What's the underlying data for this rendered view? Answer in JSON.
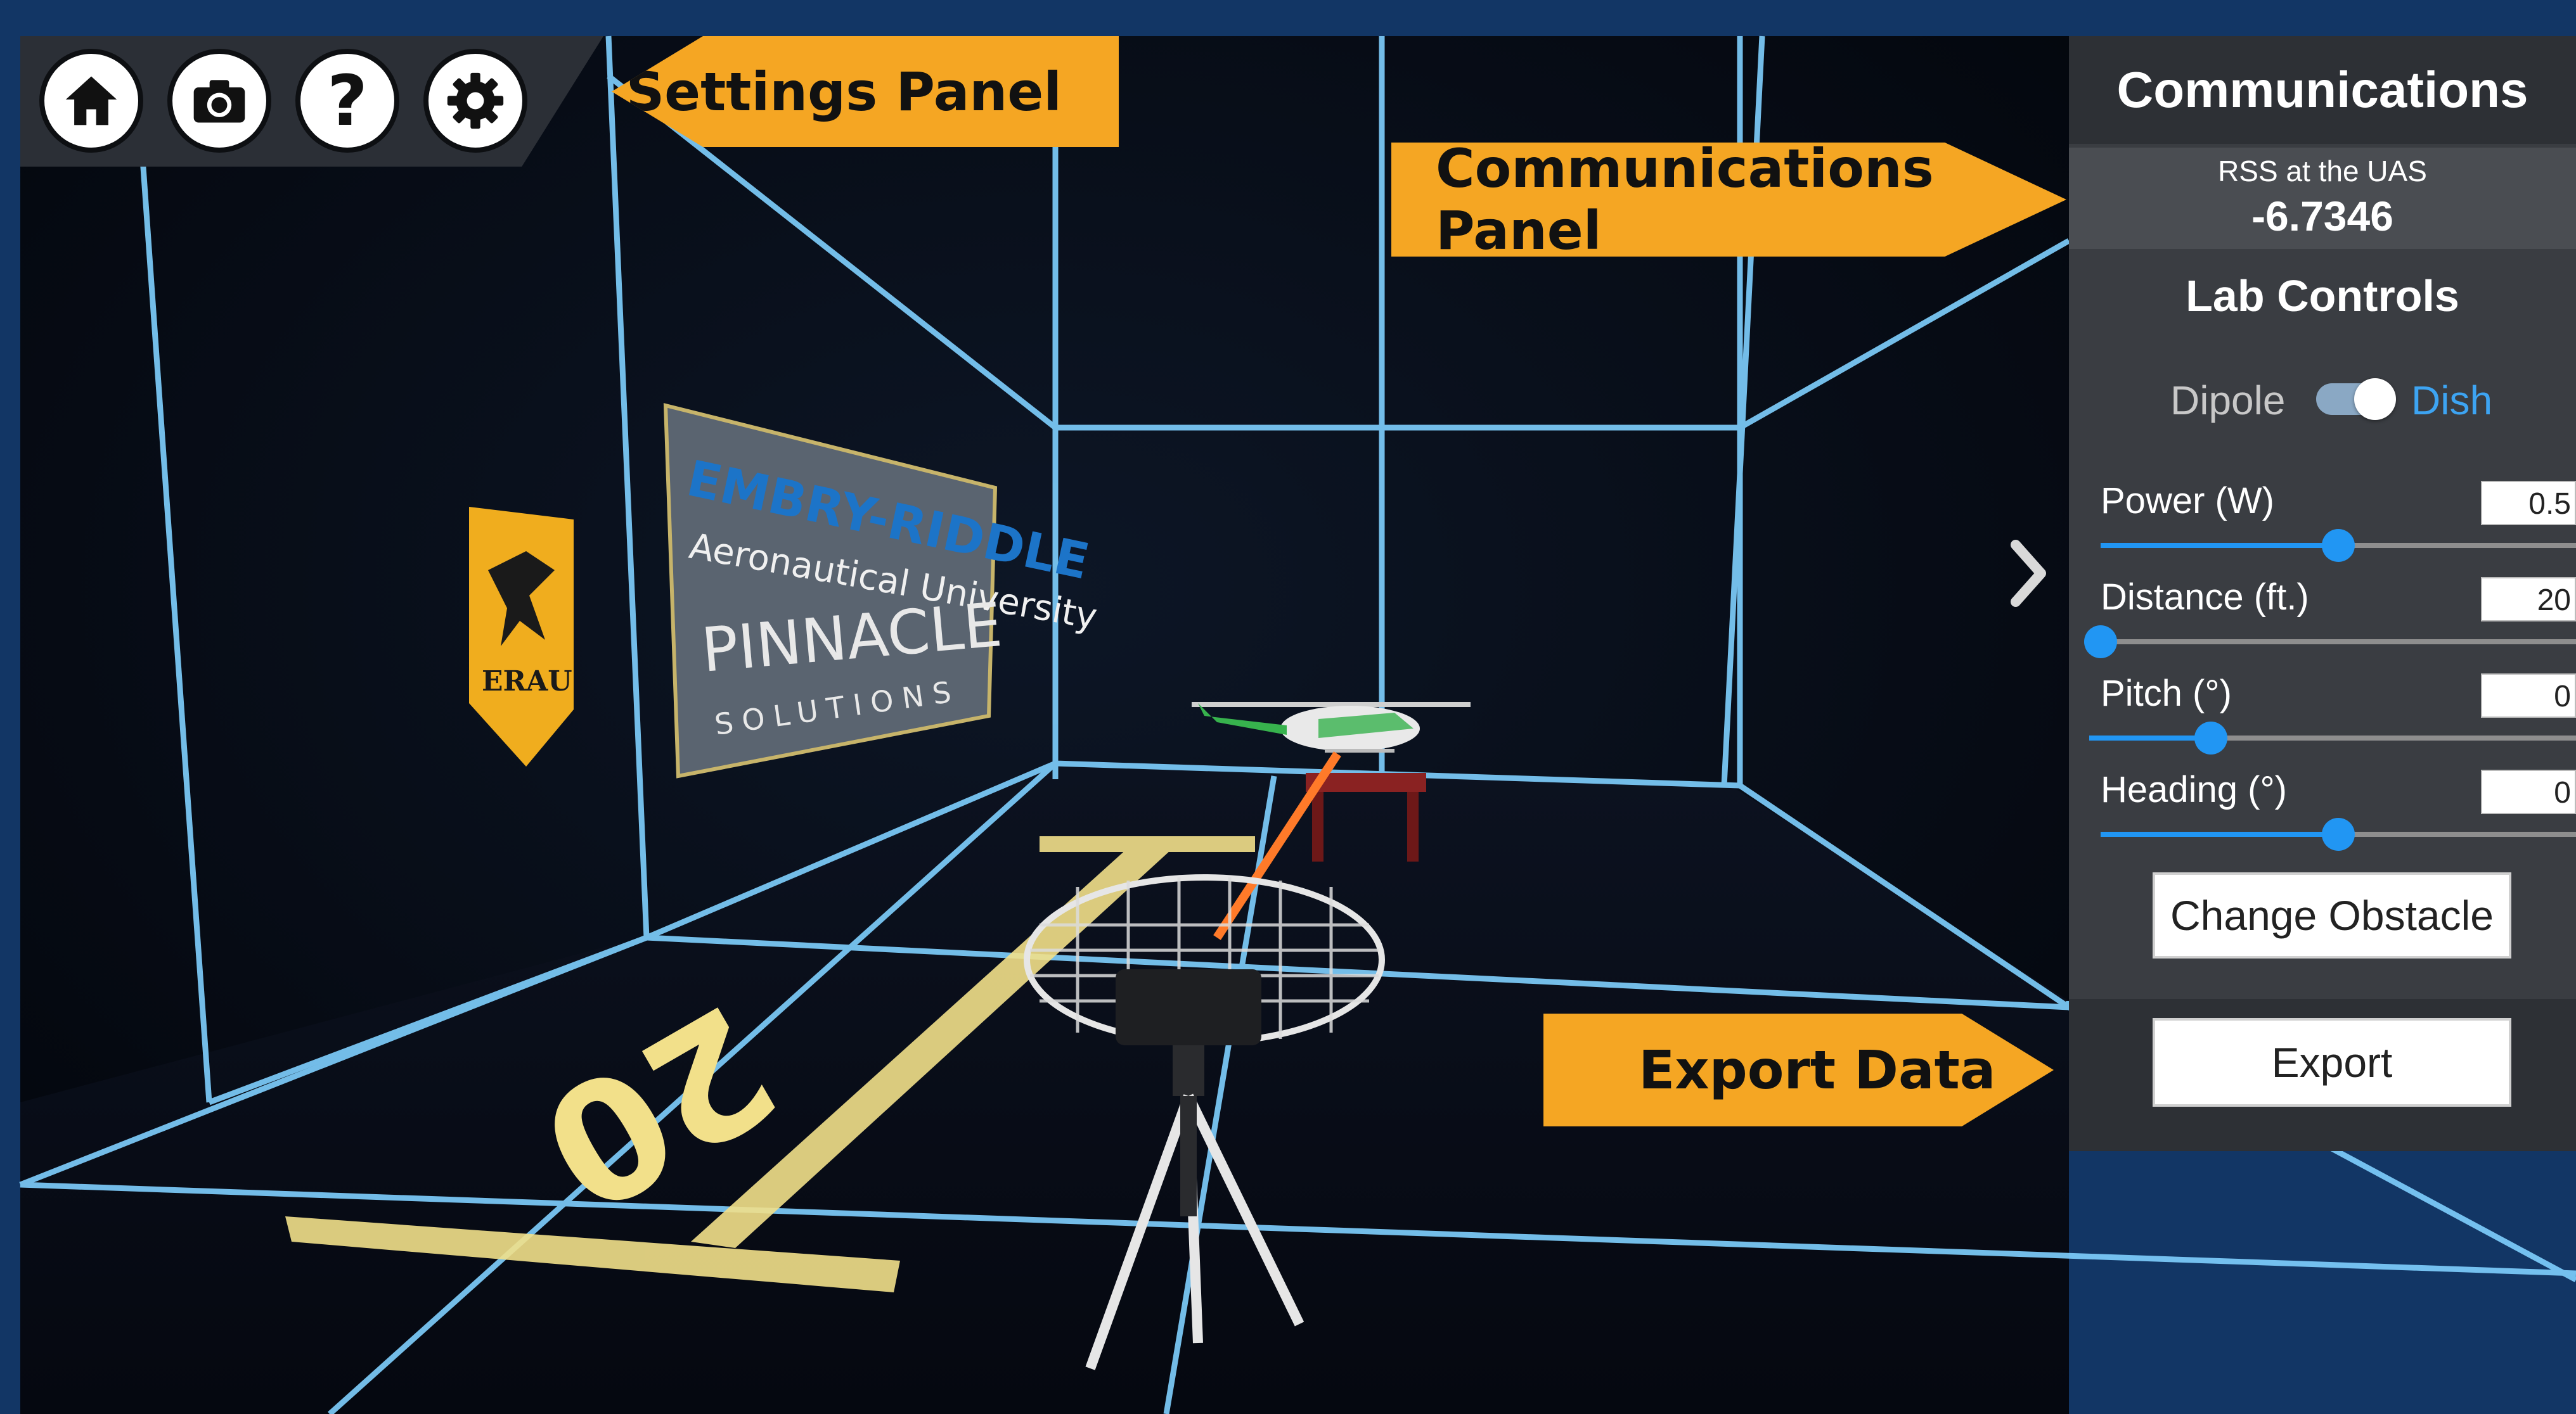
{
  "toolbar": {
    "home_icon": "home-icon",
    "camera_icon": "camera-icon",
    "help_icon": "help-icon",
    "help_glyph": "?",
    "settings_icon": "gear-icon"
  },
  "callouts": {
    "settings_panel": "Settings Panel",
    "communications_panel": "Communications Panel",
    "export_data": "Export Data"
  },
  "panel": {
    "title": "Communications",
    "rss_label": "RSS at the UAS",
    "rss_value": "-6.7346",
    "lab_controls_title": "Lab Controls",
    "antenna_toggle": {
      "left_label": "Dipole",
      "right_label": "Dish",
      "selected": "Dish"
    },
    "controls": [
      {
        "label": "Power (W)",
        "value": "0.5",
        "slider_fraction": 0.5
      },
      {
        "label": "Distance (ft.)",
        "value": "20",
        "slider_fraction": 0.0
      },
      {
        "label": "Pitch (°)",
        "value": "0",
        "slider_fraction": 0.25
      },
      {
        "label": "Heading (°)",
        "value": "0",
        "slider_fraction": 0.5
      }
    ],
    "change_obstacle_label": "Change Obstacle",
    "export_label": "Export"
  },
  "scene": {
    "banner_erau_text": "ERAU",
    "banner_line1": "EMBRY-RIDDLE",
    "banner_line2": "Aeronautical University",
    "banner_line3": "PINNACLE",
    "banner_line4": "SOLUTIONS",
    "floor_marking": "20",
    "expand_icon": "chevron-right-icon"
  },
  "colors": {
    "background_frame": "#123665",
    "callout": "#f5a623",
    "accent_blue": "#2196f3",
    "grid_line": "#7fd0ff"
  }
}
